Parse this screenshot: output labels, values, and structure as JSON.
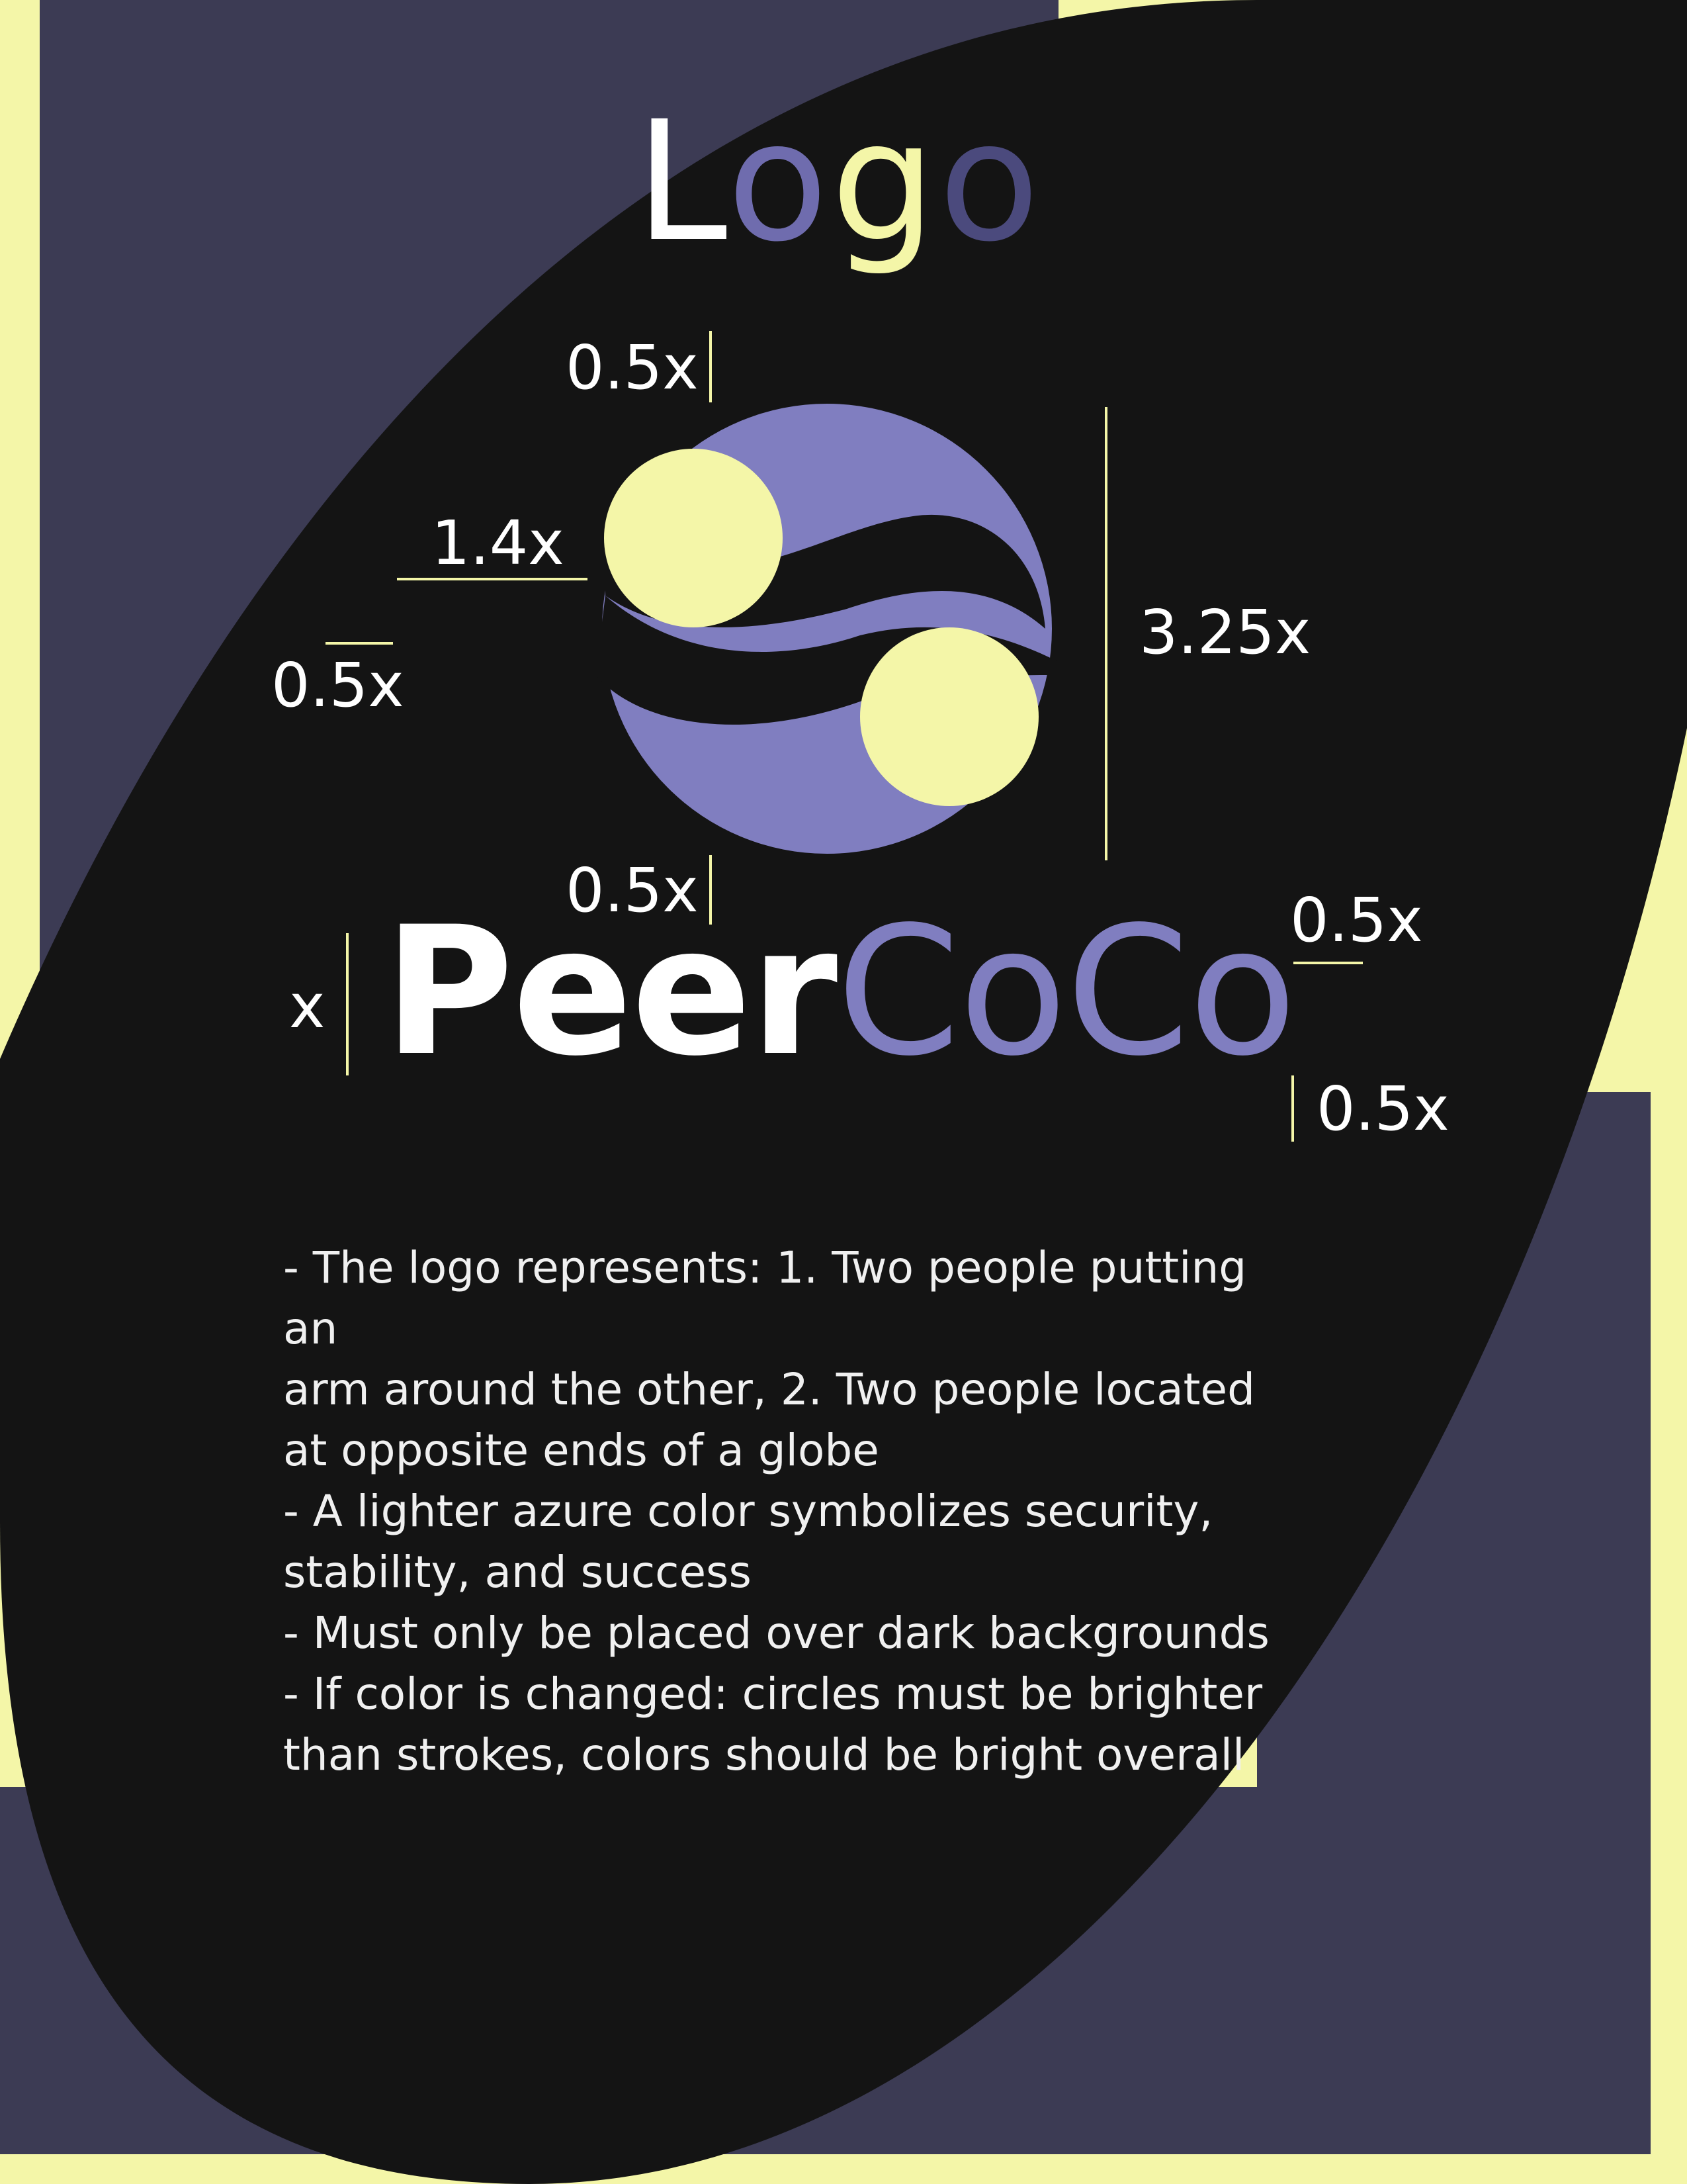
{
  "colors": {
    "cream": "#f4f6a8",
    "navy": "#3c3b54",
    "dark": "#141414",
    "purple": "#807ec0",
    "white": "#ffffff"
  },
  "title": {
    "letters": [
      "L",
      "o",
      "g",
      "o"
    ]
  },
  "dimensions": {
    "top_spacing": "0.5x",
    "circle_offset": "1.4x",
    "left_spacing": "0.5x",
    "logo_height": "3.25x",
    "bottom_spacing": "0.5x",
    "wordmark_height": "x",
    "wordmark_top_right": "0.5x",
    "wordmark_bottom_right": "0.5x"
  },
  "wordmark": {
    "part1": "Peer",
    "part2": "CoCo"
  },
  "description": [
    "- The logo represents: 1. Two people putting an\n   arm around the other, 2. Two people located\n   at opposite ends of a globe",
    "- A lighter azure color symbolizes security,\n  stability, and success",
    "- Must only be placed over dark backgrounds",
    "- If color is changed: circles must be brighter\n   than strokes, colors should be bright overall"
  ]
}
